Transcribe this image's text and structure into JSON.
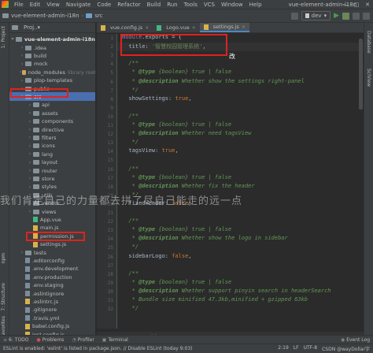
{
  "menubar": {
    "items": [
      "File",
      "Edit",
      "View",
      "Navigate",
      "Code",
      "Refactor",
      "Build",
      "Run",
      "Tools",
      "VCS",
      "Window",
      "Help"
    ],
    "title": "vue-element-admin-i18n",
    "controls": [
      "—",
      "□",
      "✕"
    ]
  },
  "navbar": {
    "project": "vue-element-admin-i18n",
    "folder": "src",
    "run_config": "dev"
  },
  "side_tabs": {
    "project": "1: Project",
    "structure": "7: Structure",
    "favorites": "2: Favorites",
    "npm": "npm",
    "database": "Database",
    "schview": "SciView"
  },
  "project_panel": {
    "header": "Proj..▾",
    "root": "vue-element-admin-i18n",
    "root_path": "D:\\...",
    "items": [
      {
        "label": ".idea",
        "type": "folder"
      },
      {
        "label": "build",
        "type": "folder"
      },
      {
        "label": "mock",
        "type": "folder"
      },
      {
        "label": "node_modules",
        "type": "folder-orange",
        "note": "library root"
      },
      {
        "label": "plop-templates",
        "type": "folder"
      },
      {
        "label": "public",
        "type": "folder"
      },
      {
        "label": "src",
        "type": "folder-blue"
      },
      {
        "label": "api",
        "type": "folder"
      },
      {
        "label": "assets",
        "type": "folder"
      },
      {
        "label": "components",
        "type": "folder"
      },
      {
        "label": "directive",
        "type": "folder"
      },
      {
        "label": "filters",
        "type": "folder"
      },
      {
        "label": "icons",
        "type": "folder"
      },
      {
        "label": "lang",
        "type": "folder"
      },
      {
        "label": "layout",
        "type": "folder"
      },
      {
        "label": "router",
        "type": "folder"
      },
      {
        "label": "store",
        "type": "folder"
      },
      {
        "label": "styles",
        "type": "folder"
      },
      {
        "label": "utils",
        "type": "folder"
      },
      {
        "label": "vendor",
        "type": "folder"
      },
      {
        "label": "views",
        "type": "folder"
      },
      {
        "label": "App.vue",
        "type": "vue"
      },
      {
        "label": "main.js",
        "type": "js"
      },
      {
        "label": "permission.js",
        "type": "js"
      },
      {
        "label": "settings.js",
        "type": "js"
      },
      {
        "label": "tests",
        "type": "folder"
      },
      {
        "label": ".editorconfig",
        "type": "cfg"
      },
      {
        "label": ".env.development",
        "type": "cfg"
      },
      {
        "label": ".env.production",
        "type": "cfg"
      },
      {
        "label": ".env.staging",
        "type": "cfg"
      },
      {
        "label": ".eslintignore",
        "type": "cfg"
      },
      {
        "label": ".eslintrc.js",
        "type": "js"
      },
      {
        "label": ".gitignore",
        "type": "cfg"
      },
      {
        "label": ".travis.yml",
        "type": "cfg"
      },
      {
        "label": "babel.config.js",
        "type": "js"
      },
      {
        "label": "jest.config.js",
        "type": "js"
      }
    ]
  },
  "editor": {
    "tabs": [
      {
        "label": "vue.config.js",
        "active": false
      },
      {
        "label": "Logo.vue",
        "active": false
      },
      {
        "label": "settings.js",
        "active": true
      }
    ],
    "lines": [
      [
        {
          "t": "module",
          "c": "c-prop"
        },
        {
          "t": ".exports = {",
          "c": ""
        }
      ],
      [
        {
          "t": "  title: ",
          "c": ""
        },
        {
          "t": "'智慧校园管理系统'",
          "c": "c-str"
        },
        {
          "t": ",",
          "c": ""
        }
      ],
      [],
      [
        {
          "t": "  /**",
          "c": "c-doc"
        }
      ],
      [
        {
          "t": "   * ",
          "c": "c-doc"
        },
        {
          "t": "@type",
          "c": "c-tag"
        },
        {
          "t": " {boolean} true | false",
          "c": "c-doc"
        }
      ],
      [
        {
          "t": "   * ",
          "c": "c-doc"
        },
        {
          "t": "@description",
          "c": "c-tag"
        },
        {
          "t": " Whether show the settings right-panel",
          "c": "c-doc"
        }
      ],
      [
        {
          "t": "   */",
          "c": "c-doc"
        }
      ],
      [
        {
          "t": "  showSettings: ",
          "c": ""
        },
        {
          "t": "true",
          "c": "c-kw"
        },
        {
          "t": ",",
          "c": ""
        }
      ],
      [],
      [
        {
          "t": "  /**",
          "c": "c-doc"
        }
      ],
      [
        {
          "t": "   * ",
          "c": "c-doc"
        },
        {
          "t": "@type",
          "c": "c-tag"
        },
        {
          "t": " {boolean} true | false",
          "c": "c-doc"
        }
      ],
      [
        {
          "t": "   * ",
          "c": "c-doc"
        },
        {
          "t": "@description",
          "c": "c-tag"
        },
        {
          "t": " Whether need tagsView",
          "c": "c-doc"
        }
      ],
      [
        {
          "t": "   */",
          "c": "c-doc"
        }
      ],
      [
        {
          "t": "  tagsView: ",
          "c": ""
        },
        {
          "t": "true",
          "c": "c-kw"
        },
        {
          "t": ",",
          "c": ""
        }
      ],
      [],
      [
        {
          "t": "  /**",
          "c": "c-doc"
        }
      ],
      [
        {
          "t": "   * ",
          "c": "c-doc"
        },
        {
          "t": "@type",
          "c": "c-tag"
        },
        {
          "t": " {boolean} true | false",
          "c": "c-doc"
        }
      ],
      [
        {
          "t": "   * ",
          "c": "c-doc"
        },
        {
          "t": "@description",
          "c": "c-tag"
        },
        {
          "t": " Whether fix the header",
          "c": "c-doc"
        }
      ],
      [
        {
          "t": "   */",
          "c": "c-doc"
        }
      ],
      [
        {
          "t": "  fixedHeader: ",
          "c": ""
        },
        {
          "t": "false",
          "c": "c-kw"
        },
        {
          "t": ",",
          "c": ""
        }
      ],
      [],
      [
        {
          "t": "  /**",
          "c": "c-doc"
        }
      ],
      [
        {
          "t": "   * ",
          "c": "c-doc"
        },
        {
          "t": "@type",
          "c": "c-tag"
        },
        {
          "t": " {boolean} true | false",
          "c": "c-doc"
        }
      ],
      [
        {
          "t": "   * ",
          "c": "c-doc"
        },
        {
          "t": "@description",
          "c": "c-tag"
        },
        {
          "t": " Whether show the logo in sidebar",
          "c": "c-doc"
        }
      ],
      [
        {
          "t": "   */",
          "c": "c-doc"
        }
      ],
      [
        {
          "t": "  sidebarLogo: ",
          "c": ""
        },
        {
          "t": "false",
          "c": "c-kw"
        },
        {
          "t": ",",
          "c": ""
        }
      ],
      [],
      [
        {
          "t": "  /**",
          "c": "c-doc"
        }
      ],
      [
        {
          "t": "   * ",
          "c": "c-doc"
        },
        {
          "t": "@type",
          "c": "c-tag"
        },
        {
          "t": " {boolean} true | false",
          "c": "c-doc"
        }
      ],
      [
        {
          "t": "   * ",
          "c": "c-doc"
        },
        {
          "t": "@description",
          "c": "c-tag"
        },
        {
          "t": " Whether support pinyin search in headerSearch",
          "c": "c-doc"
        }
      ],
      [
        {
          "t": "   * Bundle size minified 47.3kb,minified + gzipped 63kb",
          "c": "c-doc"
        }
      ],
      [
        {
          "t": "   */",
          "c": "c-doc"
        }
      ]
    ],
    "annotation": "改",
    "breadcrumb": [
      "exports",
      "title"
    ]
  },
  "watermark": "我们肯定自己的力量都去拼了尽自己能走的远一点",
  "bottom_tools": [
    "6: TODO",
    "Problems",
    "Profiler",
    "Terminal"
  ],
  "event_log": "Event Log",
  "status": {
    "message": "ESLint is enabled: 'eslint' is listed in package.json. // Disable ESLint (today 9:03)",
    "position": "2:19",
    "line_sep": "LF",
    "encoding": "UTF-8",
    "extra": "CSDN @wayDollar字"
  },
  "colors": {
    "highlight": "#e0221e",
    "selection": "#4b6eaf"
  }
}
